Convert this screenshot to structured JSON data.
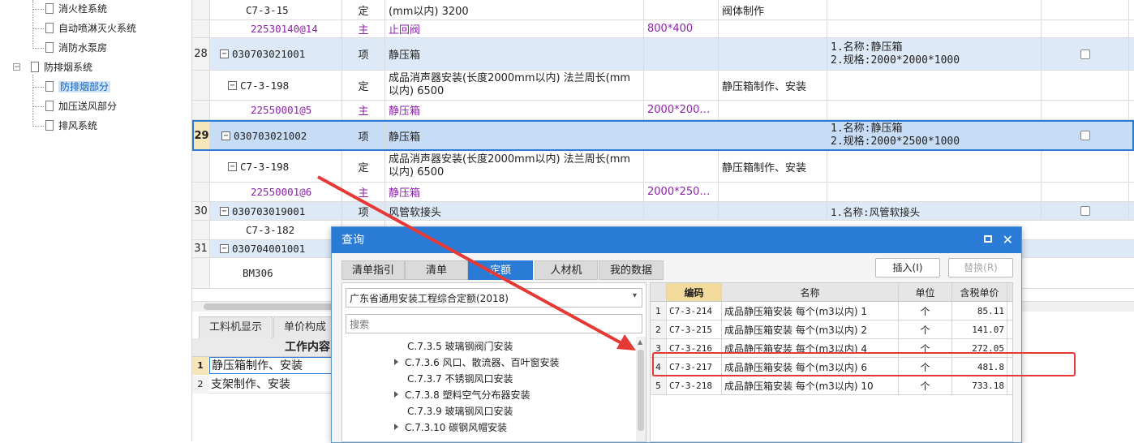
{
  "tree": {
    "items": [
      {
        "label": "消火栓系统"
      },
      {
        "label": "自动喷淋灭火系统"
      },
      {
        "label": "消防水泵房"
      },
      {
        "label": "防排烟系统"
      },
      {
        "label": "防排烟部分"
      },
      {
        "label": "加压送风部分"
      },
      {
        "label": "排风系统"
      }
    ]
  },
  "grid": {
    "rows": [
      {
        "num": "",
        "code": "C7-3-15",
        "type": "定",
        "name": "(mm以内) 3200",
        "spec": "",
        "work": "阀体制作",
        "feature": ""
      },
      {
        "num": "",
        "code": "22530140@14",
        "type": "主",
        "name": "止回阀",
        "spec": "800*400",
        "work": "",
        "feature": ""
      },
      {
        "num": "28",
        "code": "030703021001",
        "type": "项",
        "name": "静压箱",
        "spec": "",
        "work": "",
        "feature": "1.名称:静压箱\n2.规格:2000*2000*1000"
      },
      {
        "num": "",
        "code": "C7-3-198",
        "type": "定",
        "name": "成品消声器安装(长度2000mm以内) 法兰周长(mm以内) 6500",
        "spec": "",
        "work": "静压箱制作、安装",
        "feature": ""
      },
      {
        "num": "",
        "code": "22550001@5",
        "type": "主",
        "name": "静压箱",
        "spec": "2000*200…",
        "work": "",
        "feature": ""
      },
      {
        "num": "29",
        "code": "030703021002",
        "type": "项",
        "name": "静压箱",
        "spec": "",
        "work": "",
        "feature": "1.名称:静压箱\n2.规格:2000*2500*1000"
      },
      {
        "num": "",
        "code": "C7-3-198",
        "type": "定",
        "name": "成品消声器安装(长度2000mm以内) 法兰周长(mm以内) 6500",
        "spec": "",
        "work": "静压箱制作、安装",
        "feature": ""
      },
      {
        "num": "",
        "code": "22550001@6",
        "type": "主",
        "name": "静压箱",
        "spec": "2000*250…",
        "work": "",
        "feature": ""
      },
      {
        "num": "30",
        "code": "030703019001",
        "type": "项",
        "name": "风管软接头",
        "spec": "",
        "work": "",
        "feature": "1.名称:风管软接头"
      },
      {
        "num": "",
        "code": "C7-3-182",
        "type": "",
        "name": "",
        "spec": "",
        "work": "",
        "feature": ""
      },
      {
        "num": "31",
        "code": "030704001001",
        "type": "",
        "name": "",
        "spec": "",
        "work": "",
        "feature": ""
      },
      {
        "num": "",
        "code": "BM306",
        "type": "",
        "name": "",
        "spec": "",
        "work": "",
        "feature": ""
      }
    ]
  },
  "bottom": {
    "tabs": [
      "工料机显示",
      "单价构成"
    ],
    "header": "工作内容",
    "rows": [
      {
        "num": "1",
        "text": "静压箱制作、安装"
      },
      {
        "num": "2",
        "text": "支架制作、安装"
      }
    ]
  },
  "dialog": {
    "title": "查询",
    "tabs": [
      "清单指引",
      "清单",
      "定额",
      "人材机",
      "我的数据"
    ],
    "insert_label": "插入(I)",
    "replace_label": "替换(R)",
    "dropdown_value": "广东省通用安装工程综合定额(2018)",
    "search_placeholder": "搜索",
    "categories": [
      {
        "label": "C.7.3.5 玻璃钢阀门安装",
        "arrow": false
      },
      {
        "label": "C.7.3.6 风口、散流器、百叶窗安装",
        "arrow": true
      },
      {
        "label": "C.7.3.7 不锈钢风口安装",
        "arrow": false
      },
      {
        "label": "C.7.3.8 塑料空气分布器安装",
        "arrow": true
      },
      {
        "label": "C.7.3.9 玻璃钢风口安装",
        "arrow": false
      },
      {
        "label": "C.7.3.10 碳钢风帽安装",
        "arrow": true
      }
    ],
    "table": {
      "headers": [
        "编码",
        "名称",
        "单位",
        "含税单价"
      ],
      "rows": [
        {
          "num": "1",
          "code": "C7-3-214",
          "name": "成品静压箱安装 每个(m3以内) 1",
          "unit": "个",
          "price": "85.11"
        },
        {
          "num": "2",
          "code": "C7-3-215",
          "name": "成品静压箱安装 每个(m3以内) 2",
          "unit": "个",
          "price": "141.07"
        },
        {
          "num": "3",
          "code": "C7-3-216",
          "name": "成品静压箱安装 每个(m3以内) 4",
          "unit": "个",
          "price": "272.05"
        },
        {
          "num": "4",
          "code": "C7-3-217",
          "name": "成品静压箱安装 每个(m3以内) 6",
          "unit": "个",
          "price": "481.8"
        },
        {
          "num": "5",
          "code": "C7-3-218",
          "name": "成品静压箱安装 每个(m3以内) 10",
          "unit": "个",
          "price": "733.18"
        }
      ]
    }
  },
  "colors": {
    "accent": "#2a7bd6",
    "highlight_box": "#e53935",
    "arrow": "#e53935",
    "purple_text": "#8b22a8"
  }
}
